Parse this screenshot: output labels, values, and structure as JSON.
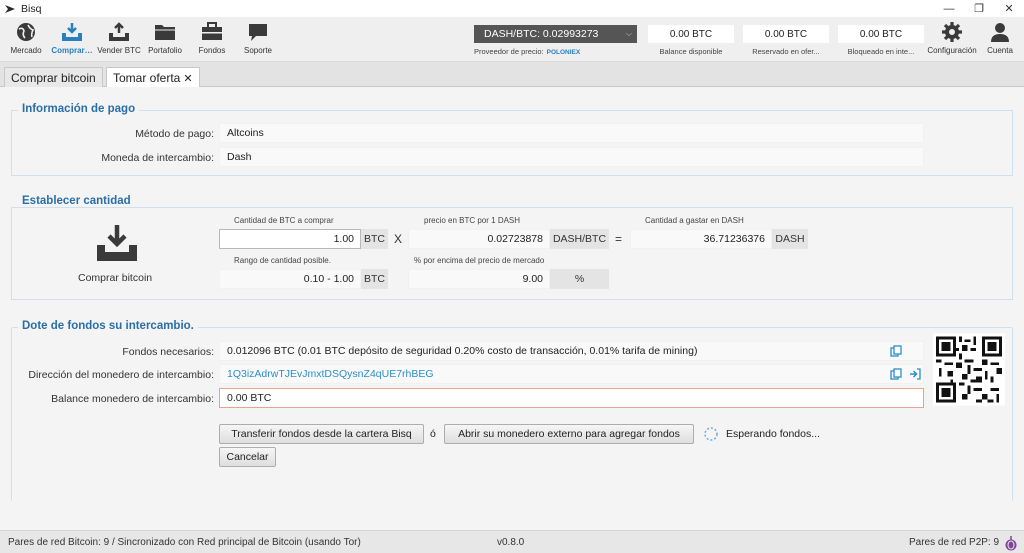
{
  "window": {
    "title": "Bisq",
    "minimize": "—",
    "restore": "❐",
    "close": "✕"
  },
  "toolbar": {
    "items": [
      {
        "label": "Mercado",
        "icon": "globe-icon"
      },
      {
        "label": "Comprar…",
        "icon": "buy-btc-icon"
      },
      {
        "label": "Vender BTC",
        "icon": "sell-btc-icon"
      },
      {
        "label": "Portafolio",
        "icon": "folder-icon"
      },
      {
        "label": "Fondos",
        "icon": "briefcase-icon"
      },
      {
        "label": "Soporte",
        "icon": "chat-icon"
      }
    ],
    "price": {
      "value": "DASH/BTC: 0.02993273",
      "provider_label": "Proveedor de precio:",
      "provider": "POLONIEX"
    },
    "balances": [
      {
        "value": "0.00 BTC",
        "label": "Balance disponible"
      },
      {
        "value": "0.00 BTC",
        "label": "Reservado en ofer..."
      },
      {
        "value": "0.00 BTC",
        "label": "Bloqueado en inte..."
      }
    ],
    "settings_label": "Configuración",
    "account_label": "Cuenta"
  },
  "tabs": [
    {
      "label": "Comprar bitcoin"
    },
    {
      "label": "Tomar oferta",
      "close": "✕"
    }
  ],
  "payment_info": {
    "title": "Información de pago",
    "method_label": "Método de pago:",
    "method_value": "Altcoins",
    "currency_label": "Moneda de intercambio:",
    "currency_value": "Dash"
  },
  "amount": {
    "title": "Establecer cantidad",
    "side_label": "Comprar bitcoin",
    "btc_amount_label": "Cantidad de BTC a comprar",
    "btc_amount_value": "1.00",
    "btc_unit": "BTC",
    "times": "X",
    "price_label": "precio en BTC por 1 DASH",
    "price_value": "0.02723878",
    "price_unit": "DASH/BTC",
    "equals": "=",
    "total_label": "Cantidad a gastar en DASH",
    "total_value": "36.71236376",
    "total_unit": "DASH",
    "range_label": "Rango de cantidad posible.",
    "range_value": "0.10 - 1.00",
    "range_unit": "BTC",
    "pct_label": "% por encima del precio de mercado",
    "pct_value": "9.00",
    "pct_unit": "%"
  },
  "funding": {
    "title": "Dote de fondos su intercambio.",
    "needed_label": "Fondos necesarios:",
    "needed_value": "0.012096 BTC (0.01 BTC depósito de seguridad 0.20% costo de transacción, 0.01% tarifa de mining)",
    "address_label": "Dirección del monedero de intercambio:",
    "address_value": "1Q3izAdrwTJEvJmxtDSQysnZ4qUE7rhBEG",
    "balance_label": "Balance monedero de intercambio:",
    "balance_value": "0.00 BTC"
  },
  "actions": {
    "transfer_button": "Transferir fondos desde la cartera Bisq",
    "or": "ó",
    "external_button": "Abrir su monedero externo para agregar fondos",
    "waiting": "Esperando fondos...",
    "cancel_button": "Cancelar"
  },
  "status": {
    "left": "Pares de red Bitcoin: 9 / Sincronizado con Red principal de Bitcoin (usando Tor)",
    "version": "v0.8.0",
    "right": "Pares de red P2P: 9"
  },
  "colors": {
    "accent": "#2a6ea7",
    "link": "#2a8fc8",
    "warn_border": "#e9a58b"
  }
}
